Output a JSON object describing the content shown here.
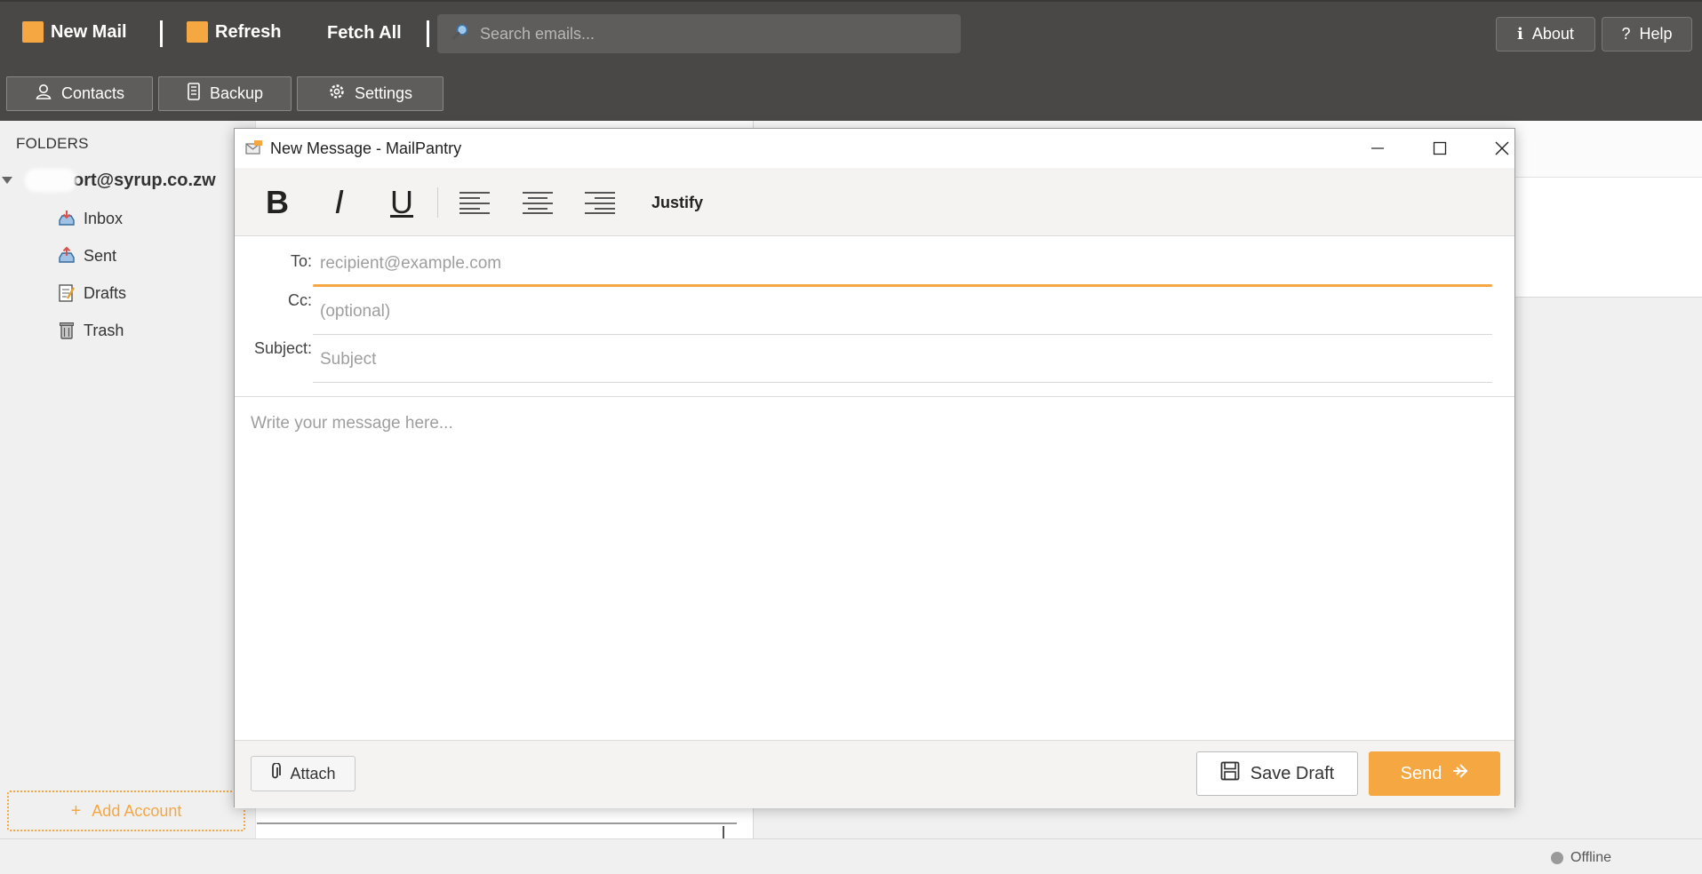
{
  "toolbar": {
    "new_mail": "New Mail",
    "refresh": "Refresh",
    "fetch_all": "Fetch All",
    "search_placeholder": "Search emails...",
    "about": "About",
    "help": "Help"
  },
  "nav": {
    "contacts": "Contacts",
    "backup": "Backup",
    "settings": "Settings"
  },
  "sidebar": {
    "folders_title": "FOLDERS",
    "account_label": "ort@syrup.co.zw",
    "folders": [
      {
        "label": "Inbox",
        "icon": "inbox-icon"
      },
      {
        "label": "Sent",
        "icon": "sent-icon"
      },
      {
        "label": "Drafts",
        "icon": "drafts-icon"
      },
      {
        "label": "Trash",
        "icon": "trash-icon"
      }
    ],
    "add_account": "Add Account"
  },
  "status": {
    "text": "Offline"
  },
  "compose": {
    "window_title": "New Message - MailPantry",
    "format": {
      "bold": "B",
      "italic": "I",
      "underline": "U",
      "justify": "Justify"
    },
    "to_label": "To:",
    "to_placeholder": "recipient@example.com",
    "cc_label": "Cc:",
    "cc_placeholder": "(optional)",
    "subject_label": "Subject:",
    "subject_placeholder": "Subject",
    "body_placeholder": "Write your message here...",
    "attach": "Attach",
    "save_draft": "Save Draft",
    "send": "Send"
  },
  "colors": {
    "accent": "#f5a742",
    "toolbar_bg": "#4a4847"
  }
}
